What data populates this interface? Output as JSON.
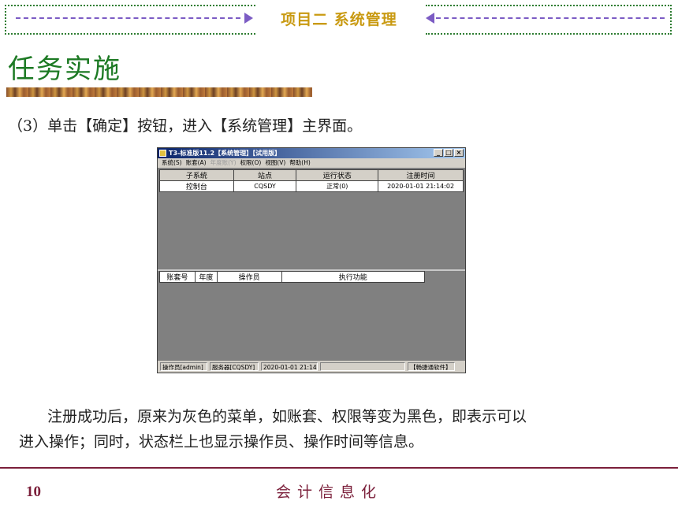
{
  "slide": {
    "header_title": "项目二  系统管理",
    "task_title": "任务实施",
    "step_text": "（3）单击【确定】按钮，进入【系统管理】主界面。",
    "explanation_line1": "注册成功后，原来为灰色的菜单，如账套、权限等变为黑色，即表示可以",
    "explanation_line2": "进入操作；同时，状态栏上也显示操作员、操作时间等信息。",
    "page_number": "10",
    "footer_title": "会计信息化"
  },
  "colors": {
    "header_gold": "#c99a12",
    "task_green": "#1d7a24",
    "footer_maroon": "#7b1f3a",
    "window_bg": "#808080"
  },
  "app_window": {
    "title": "T3-标准版11.2【系统管理】【试用版】",
    "menu": [
      {
        "label": "系统(S)",
        "enabled": true
      },
      {
        "label": "账套(A)",
        "enabled": true
      },
      {
        "label": "年度账(Y)",
        "enabled": false
      },
      {
        "label": "权限(O)",
        "enabled": true
      },
      {
        "label": "视图(V)",
        "enabled": true
      },
      {
        "label": "帮助(H)",
        "enabled": true
      }
    ],
    "top_table": {
      "headers": [
        "子系统",
        "站点",
        "运行状态",
        "注册时间"
      ],
      "rows": [
        [
          "控制台",
          "CQSDY",
          "正常(0)",
          "2020-01-01  21:14:02"
        ]
      ]
    },
    "bottom_table": {
      "headers": [
        "账套号",
        "年度",
        "操作员",
        "执行功能"
      ]
    },
    "status_bar": {
      "operator": "操作员[admin]",
      "server": "服务器[CQSDY]",
      "time": "2020-01-01 21:14",
      "brand": "【畅捷通软件】"
    }
  }
}
